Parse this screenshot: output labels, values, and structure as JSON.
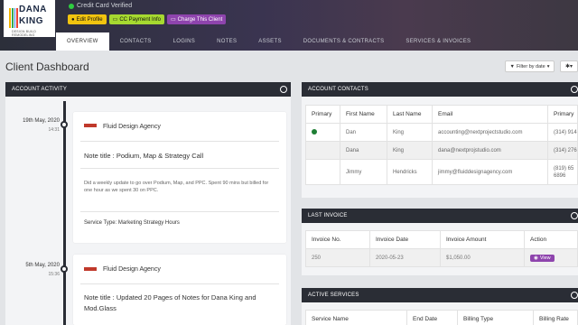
{
  "header": {
    "logo": {
      "line1": "DANA",
      "line2": "KING",
      "tagline": "DESIGN BUILD REMODELING"
    },
    "status": "Credit Card Verified",
    "buttons": {
      "edit": "Edit Profile",
      "cc": "CC Payment Info",
      "charge": "Charge This Client"
    },
    "tabs": [
      "OVERVIEW",
      "CONTACTS",
      "LOGINS",
      "NOTES",
      "ASSETS",
      "DOCUMENTS & CONTRACTS",
      "SERVICES & INVOICES"
    ]
  },
  "page": {
    "title": "Client Dashboard",
    "filter": "Filter by date",
    "filter_caret": "▾",
    "gear_caret": "▾"
  },
  "activity": {
    "heading": "ACCOUNT ACTIVITY",
    "entries": [
      {
        "date": "19th May, 2020",
        "time": "14:31",
        "agency": "Fluid Design Agency",
        "note_title": "Note title : Podium, Map & Strategy Call",
        "body": "Did a weekly update to go over Podium, Map, and PPC. Spent 90 mins but billed for one hour as we spent 30 on PPC.",
        "service": "Service Type: Marketing Strategy Hours"
      },
      {
        "date": "5th May, 2020",
        "time": "15:36",
        "agency": "Fluid Design Agency",
        "note_title": "Note title : Updated 20 Pages of Notes for Dana King and Mod.Glass"
      }
    ]
  },
  "contacts": {
    "heading": "ACCOUNT CONTACTS",
    "columns": [
      "Primary",
      "First Name",
      "Last Name",
      "Email",
      "Primary"
    ],
    "rows": [
      {
        "primary": true,
        "first": "Dan",
        "last": "King",
        "email": "accounting@nextprojectstudio.com",
        "phone": "(314) 914"
      },
      {
        "primary": false,
        "first": "Dana",
        "last": "King",
        "email": "dana@nextprojstudio.com",
        "phone": "(314) 276"
      },
      {
        "primary": false,
        "first": "Jimmy",
        "last": "Hendricks",
        "email": "jimmy@fluiddesignagency.com",
        "phone": "(819) 65\n6896"
      }
    ]
  },
  "invoice": {
    "heading": "LAST INVOICE",
    "columns": [
      "Invoice No.",
      "Invoice Date",
      "Invoice Amount",
      "Action"
    ],
    "row": {
      "no": "250",
      "date": "2020-05-23",
      "amount": "$1,050.00",
      "action": "View"
    }
  },
  "services": {
    "heading": "ACTIVE SERVICES",
    "columns": [
      "Service Name",
      "End Date",
      "Billing Type",
      "Billing Rate"
    ]
  }
}
